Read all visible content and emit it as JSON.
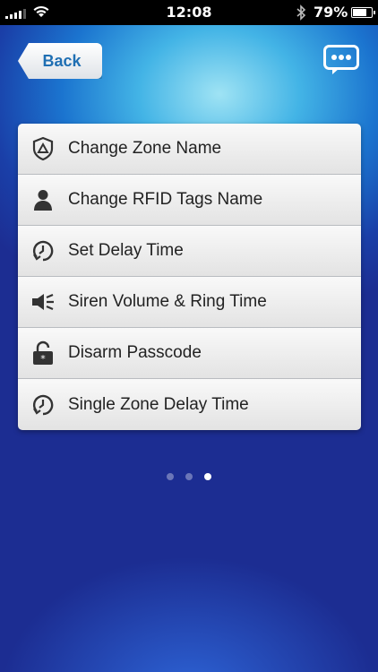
{
  "status_bar": {
    "time": "12:08",
    "battery_percent": "79%",
    "battery_level": 0.79,
    "signal_icon": "signal-bars-icon",
    "wifi_icon": "wifi-icon",
    "bluetooth_icon": "bluetooth-icon"
  },
  "nav": {
    "back_label": "Back",
    "chat_icon": "chat-bubble-icon"
  },
  "menu": {
    "items": [
      {
        "label": "Change Zone Name",
        "icon": "zone-shield-icon"
      },
      {
        "label": "Change RFID Tags Name",
        "icon": "person-icon"
      },
      {
        "label": "Set Delay Time",
        "icon": "clock-timer-icon"
      },
      {
        "label": "Siren Volume & Ring Time",
        "icon": "speaker-icon"
      },
      {
        "label": "Disarm Passcode",
        "icon": "unlock-icon"
      },
      {
        "label": "Single Zone Delay Time",
        "icon": "clock-timer-icon"
      }
    ]
  },
  "pager": {
    "total": 3,
    "current": 3
  },
  "colors": {
    "accent": "#1f6fb3",
    "background_top": "#9fe3f4",
    "background_bottom": "#1c2d92"
  }
}
